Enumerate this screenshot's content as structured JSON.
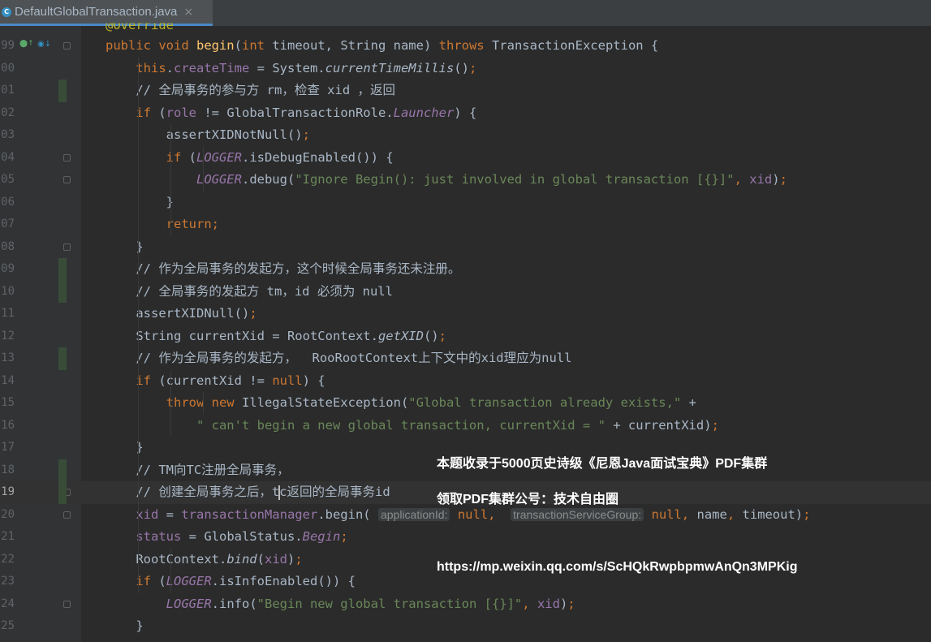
{
  "tab": {
    "title": "DefaultGlobalTransaction.java",
    "close": "×",
    "icon_letter": "C"
  },
  "partial_top_line": "@Override",
  "lines": [
    {
      "n": "99",
      "html": "<span class='kw'>public void </span><span class='fn'>begin</span>(<span class='kw'>int </span>timeout, String name) <span class='kw'>throws </span>TransactionException {"
    },
    {
      "n": "00",
      "html": "    <span class='kw'>this</span>.<span class='fld'>createTime </span>= System.<span class='itl'>currentTimeMillis</span>()<span class='kw'>;</span>"
    },
    {
      "n": "01",
      "html": "    <span class='cmt'>// 全局事务的参与方 rm，检查 xid ，返回</span>"
    },
    {
      "n": "02",
      "html": "    <span class='kw'>if </span>(<span class='fld'>role </span>!= GlobalTransactionRole.<span class='fld itl'>Launcher</span>) {"
    },
    {
      "n": "03",
      "html": "        assertXIDNotNull()<span class='kw'>;</span>"
    },
    {
      "n": "04",
      "html": "        <span class='kw'>if </span>(<span class='fld itl'>LOGGER</span>.isDebugEnabled()) {"
    },
    {
      "n": "05",
      "html": "            <span class='fld itl'>LOGGER</span>.debug(<span class='str'>\"Ignore Begin(): just involved in global transaction [{}]\"</span><span class='kw'>, </span><span class='fld'>xid</span>)<span class='kw'>;</span>"
    },
    {
      "n": "06",
      "html": "        }"
    },
    {
      "n": "07",
      "html": "        <span class='kw'>return;</span>"
    },
    {
      "n": "08",
      "html": "    }"
    },
    {
      "n": "09",
      "html": "    <span class='cmt'>// 作为全局事务的发起方，这个时候全局事务还未注册。</span>"
    },
    {
      "n": "10",
      "html": "    <span class='cmt'>// 全局事务的发起方 tm，id 必须为 null</span>"
    },
    {
      "n": "11",
      "html": "    assertXIDNull()<span class='kw'>;</span>"
    },
    {
      "n": "12",
      "html": "    String currentXid = RootContext.<span class='itl'>getXID</span>()<span class='kw'>;</span>"
    },
    {
      "n": "13",
      "html": "    <span class='cmt'>// 作为全局事务的发起方，  RooRootContext上下文中的xid理应为null</span>"
    },
    {
      "n": "14",
      "html": "    <span class='kw'>if </span>(currentXid != <span class='kw'>null</span>) {"
    },
    {
      "n": "15",
      "html": "        <span class='kw'>throw new </span>IllegalStateException(<span class='str'>\"Global transaction already exists,\"</span> +"
    },
    {
      "n": "16",
      "html": "            <span class='str'>\" can't begin a new global transaction, currentXid = \"</span> + currentXid)<span class='kw'>;</span>"
    },
    {
      "n": "17",
      "html": "    }"
    },
    {
      "n": "18",
      "html": "    <span class='cmt'>// TM向TC注册全局事务，</span>"
    },
    {
      "n": "19",
      "html": "    <span class='cmt'>// 创建全局事务之后，tc返回的全局事务id</span>"
    },
    {
      "n": "20",
      "html": "    <span class='fld'>xid </span>= <span class='fld'>transactionManager</span>.begin( <span class='hint'>applicationId:</span> <span class='kw'>null, </span> <span class='hint'>transactionServiceGroup:</span> <span class='kw'>null, </span>name<span class='kw'>, </span>timeout)<span class='kw'>;</span>"
    },
    {
      "n": "21",
      "html": "    <span class='fld'>status </span>= GlobalStatus.<span class='fld itl'>Begin</span><span class='kw'>;</span>"
    },
    {
      "n": "22",
      "html": "    RootContext.<span class='itl'>bind</span>(<span class='fld'>xid</span>)<span class='kw'>;</span>"
    },
    {
      "n": "23",
      "html": "    <span class='kw'>if </span>(<span class='fld itl'>LOGGER</span>.isInfoEnabled()) {"
    },
    {
      "n": "24",
      "html": "        <span class='fld itl'>LOGGER</span>.info(<span class='str'>\"Begin new global transaction [{}]\"</span><span class='kw'>, </span><span class='fld'>xid</span>)<span class='kw'>;</span>"
    },
    {
      "n": "25",
      "html": "    }"
    }
  ],
  "current_line": "19",
  "watermark": {
    "line1": "本题收录于5000页史诗级《尼恩Java面试宝典》PDF集群",
    "line2": "领取PDF集群公号：技术自由圈",
    "line3": "https://mp.weixin.qq.com/s/ScHQkRwpbpmwAnQn3MPKig"
  },
  "colors": {
    "background": "#2b2b2b",
    "keyword": "#cc7832",
    "string": "#6a8759",
    "field": "#9876aa",
    "method_decl": "#ffc66d",
    "text": "#a9b7c6"
  }
}
